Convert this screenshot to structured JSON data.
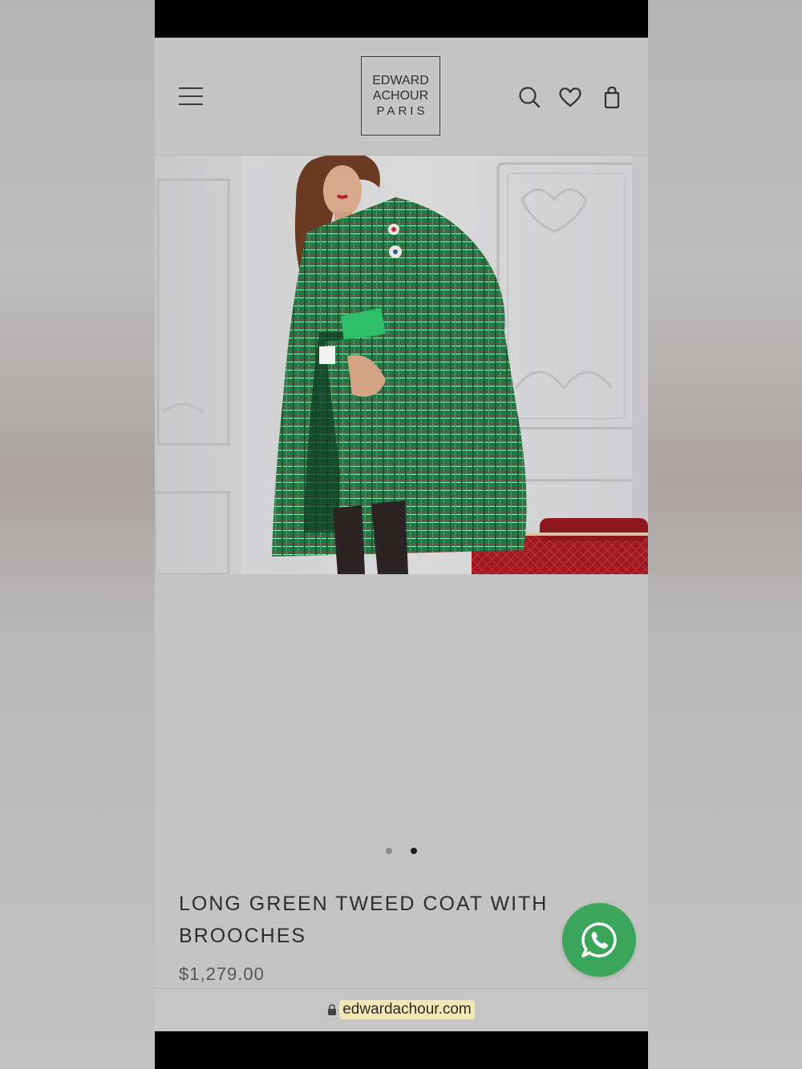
{
  "brand": {
    "line1": "EDWARD",
    "line2": "ACHOUR",
    "line3": "PARIS"
  },
  "header": {
    "icons": [
      "menu-icon",
      "search-icon",
      "heart-icon",
      "bag-icon"
    ]
  },
  "carousel": {
    "total": 2,
    "active_index": 1
  },
  "product": {
    "title": "LONG GREEN TWEED COAT WITH BROOCHES",
    "price": "$1,279.00"
  },
  "browser": {
    "url": "edwardachour.com"
  },
  "colors": {
    "whatsapp": "#3ba55c",
    "coat_green": "#1f7a45",
    "screen_bg": "#c4c4c4"
  }
}
